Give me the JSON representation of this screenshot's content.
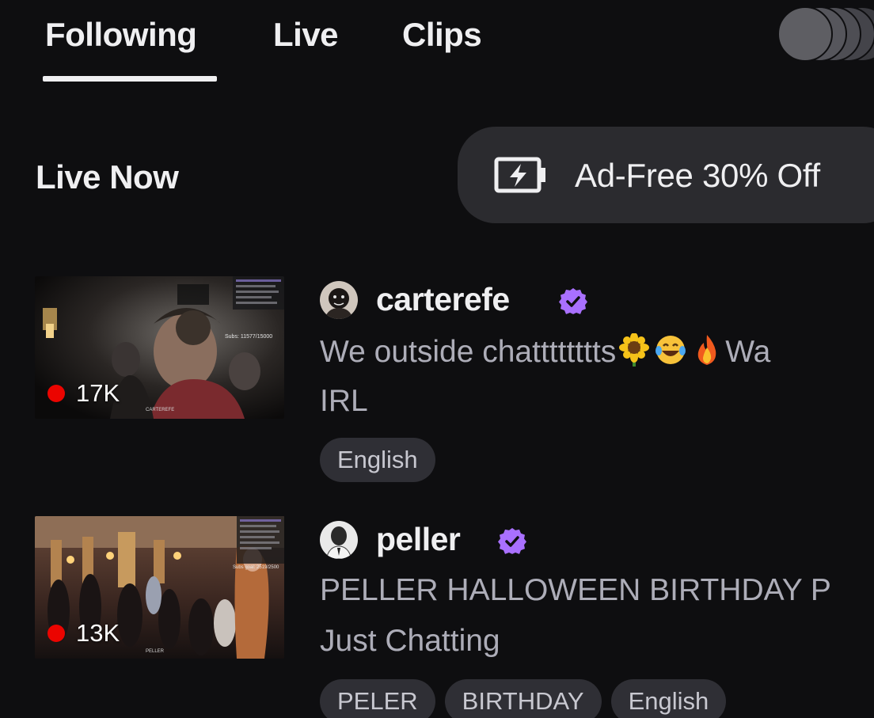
{
  "tabs": {
    "following": "Following",
    "live": "Live",
    "clips": "Clips"
  },
  "section": {
    "title": "Live Now"
  },
  "promo": {
    "label": "Ad-Free 30% Off",
    "icon": "battery-bolt-icon"
  },
  "streams": [
    {
      "channel": "carterefe",
      "verified": true,
      "title_text": "We outside chatttttttts",
      "title_emojis": [
        "sunflower",
        "tears-of-joy",
        "fire"
      ],
      "title_tail": "Wa",
      "category": "IRL",
      "viewers": "17K",
      "thumb_overlay_text": "Subs: 11577/15000",
      "thumb_watermark": "CARTEREFE",
      "tags": [
        "English"
      ]
    },
    {
      "channel": "peller",
      "verified": true,
      "title_text": "PELLER HALLOWEEN BIRTHDAY P",
      "category": "Just Chatting",
      "viewers": "13K",
      "thumb_overlay_text": "Subs goal: 2519/2500",
      "thumb_watermark": "PELLER",
      "tags": [
        "PELER",
        "BIRTHDAY",
        "English"
      ]
    }
  ],
  "colors": {
    "background": "#0e0e10",
    "verified_purple": "#a970ff",
    "live_red": "#eb0400",
    "pill": "#2b2b2f",
    "tag": "#2f2f35",
    "muted_text": "#adadb8"
  }
}
